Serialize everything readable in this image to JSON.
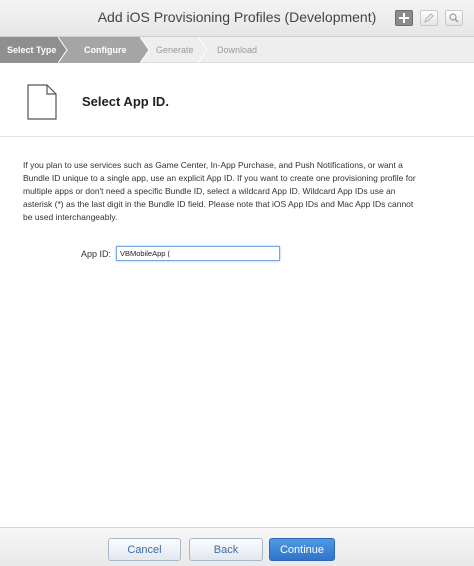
{
  "window": {
    "title": "Add iOS Provisioning Profiles (Development)"
  },
  "toolbar": {
    "add_icon": "plus-icon",
    "edit_icon": "pencil-icon",
    "search_icon": "magnifier-icon"
  },
  "steps": [
    {
      "label": "Select Type",
      "state": "done"
    },
    {
      "label": "Configure",
      "state": "current"
    },
    {
      "label": "Generate",
      "state": "pending"
    },
    {
      "label": "Download",
      "state": "pending"
    }
  ],
  "section": {
    "icon": "document-icon",
    "title": "Select App ID."
  },
  "description": "If you plan to use services such as Game Center, In-App Purchase, and Push Notifications, or want a Bundle ID unique to a single app, use an explicit App ID. If you want to create one provisioning profile for multiple apps or don't need a specific Bundle ID, select a wildcard App ID. Wildcard App IDs use an asterisk (*) as the last digit in the Bundle ID field. Please note that iOS App IDs and Mac App IDs cannot be used interchangeably.",
  "app_id": {
    "label": "App ID:",
    "value": "VBMobileApp ("
  },
  "footer": {
    "cancel_label": "Cancel",
    "back_label": "Back",
    "continue_label": "Continue"
  },
  "colors": {
    "primary_button": "#3a82d6",
    "step_done": "#8f8f8f",
    "step_current": "#a5a5a5"
  }
}
